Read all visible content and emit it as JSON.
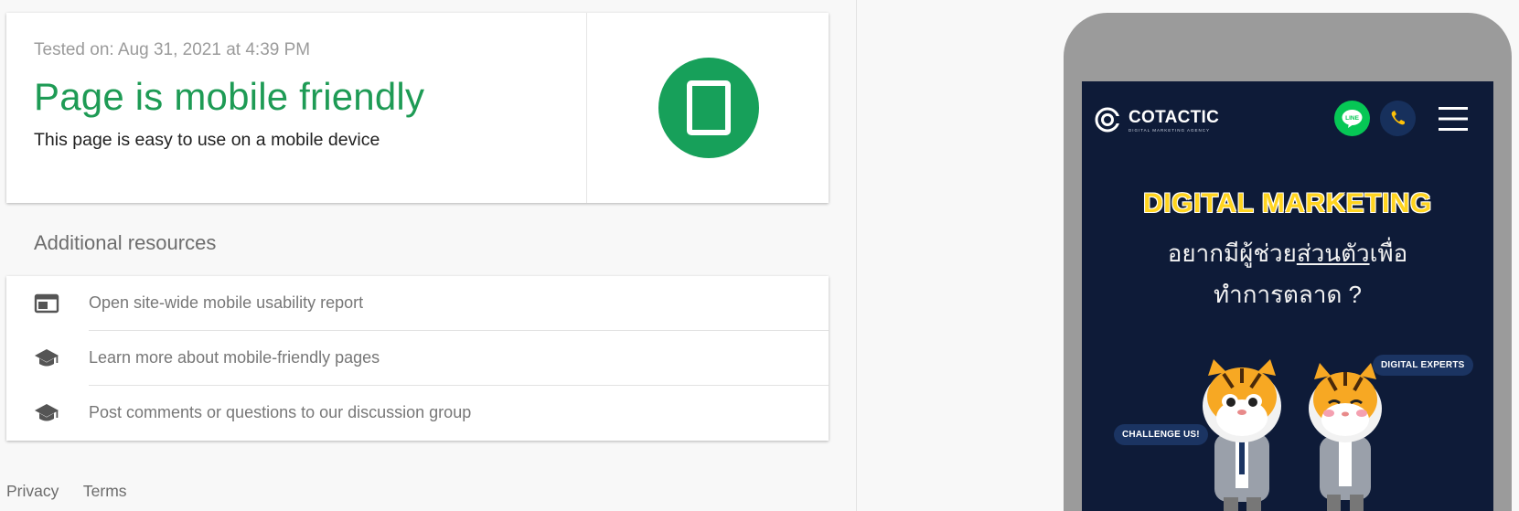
{
  "result": {
    "tested_on": "Tested on: Aug 31, 2021 at 4:39 PM",
    "verdict": "Page is mobile friendly",
    "verdict_sub": "This page is easy to use on a mobile device",
    "badge_icon": "smartphone-icon",
    "accent_color": "#1e9b55"
  },
  "resources": {
    "title": "Additional resources",
    "items": [
      {
        "icon": "web-report-icon",
        "label": "Open site-wide mobile usability report"
      },
      {
        "icon": "school-icon",
        "label": "Learn more about mobile-friendly pages"
      },
      {
        "icon": "school-icon",
        "label": "Post comments or questions to our discussion group"
      }
    ]
  },
  "footer": {
    "privacy": "Privacy",
    "terms": "Terms"
  },
  "preview": {
    "logo_text": "COTACTIC",
    "logo_tagline": "DIGITAL MARKETING AGENCY",
    "line_label": "LINE",
    "headline": "DIGITAL MARKETING",
    "thai_line1_a": "อยากมีผู้ช่วย",
    "thai_line1_b": "ส่วนตัว",
    "thai_line1_c": "เพื่อ",
    "thai_line2": "ทำการตลาด ?",
    "bubble_experts": "DIGITAL EXPERTS",
    "bubble_challenge": "CHALLENGE US!",
    "bg_color": "#0e1b38",
    "headline_color": "#ffd41f"
  }
}
